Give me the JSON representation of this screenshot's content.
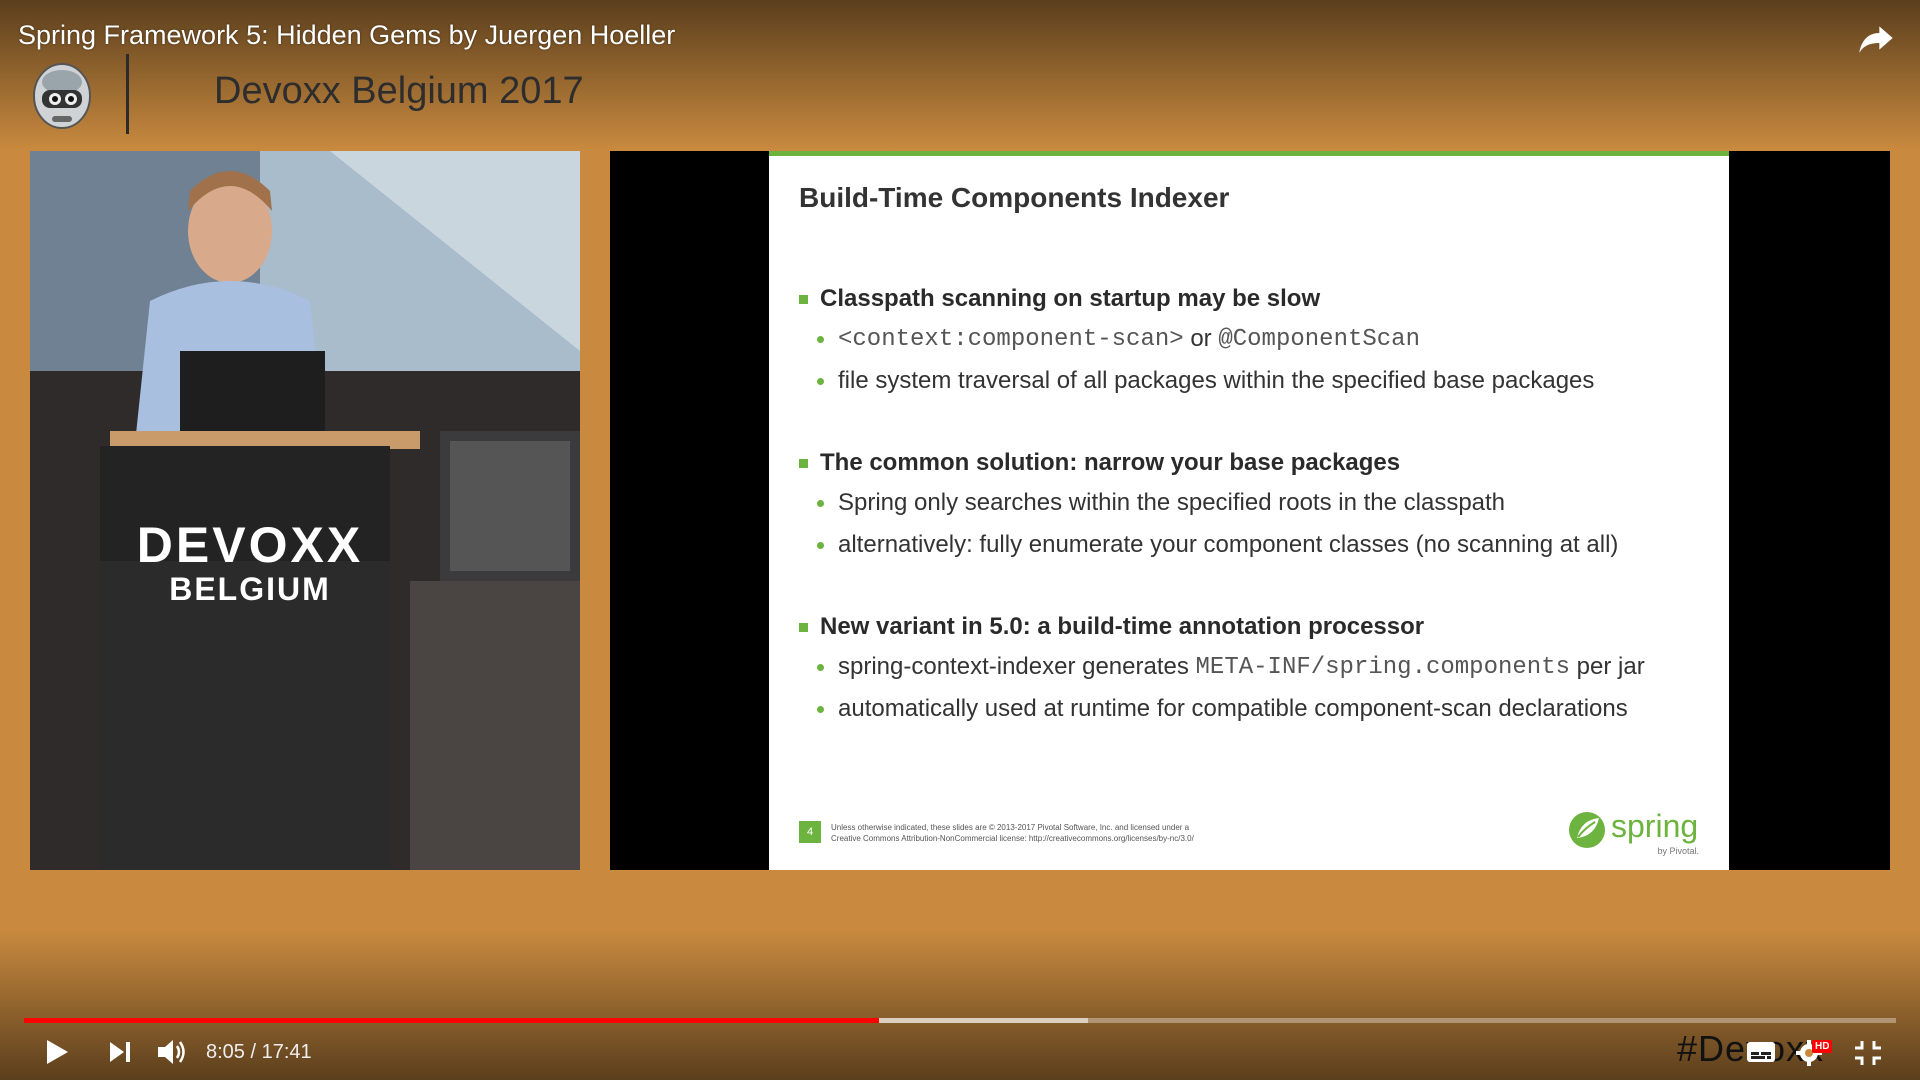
{
  "video": {
    "title": "Spring Framework 5: Hidden Gems by Juergen Hoeller"
  },
  "brand": {
    "event_name": "Devoxx Belgium 2017"
  },
  "speaker": {
    "podium_line1": "DEVOXX",
    "podium_line2": "BELGIUM"
  },
  "slide": {
    "title": "Build-Time Components Indexer",
    "sections": [
      {
        "heading": "Classpath scanning on startup may be slow",
        "items": [
          {
            "code1": "<context:component-scan>",
            "mid": " or ",
            "code2": "@ComponentScan"
          },
          {
            "text": "file system traversal of all packages within the specified base packages"
          }
        ]
      },
      {
        "heading": "The common solution: narrow your base packages",
        "items": [
          {
            "text": "Spring only searches within the specified roots in the classpath"
          },
          {
            "text": "alternatively: fully enumerate your component classes (no scanning at all)"
          }
        ]
      },
      {
        "heading": "New variant in 5.0: a build-time annotation processor",
        "items": [
          {
            "pre": "spring-context-indexer generates ",
            "code": "META-INF/spring.components",
            "post": " per jar"
          },
          {
            "text": "automatically used at runtime for compatible component-scan declarations"
          }
        ]
      }
    ],
    "page_number": "4",
    "footer_line1": "Unless otherwise indicated, these slides are © 2013-2017 Pivotal Software, Inc. and licensed under a",
    "footer_line2": "Creative Commons Attribution-NonCommercial license: http://creativecommons.org/licenses/by-nc/3.0/",
    "logo_text": "spring",
    "logo_sub": "by Pivotal."
  },
  "player": {
    "current_time": "8:05",
    "separator": " / ",
    "duration": "17:41",
    "played_fraction": 0.4567,
    "buffered_fraction": 0.5684,
    "watermark": "#Devoxx",
    "hd_badge": "HD",
    "colors": {
      "played": "#ff0000",
      "accent": "#6db33f",
      "background": "#c98a3f"
    }
  }
}
